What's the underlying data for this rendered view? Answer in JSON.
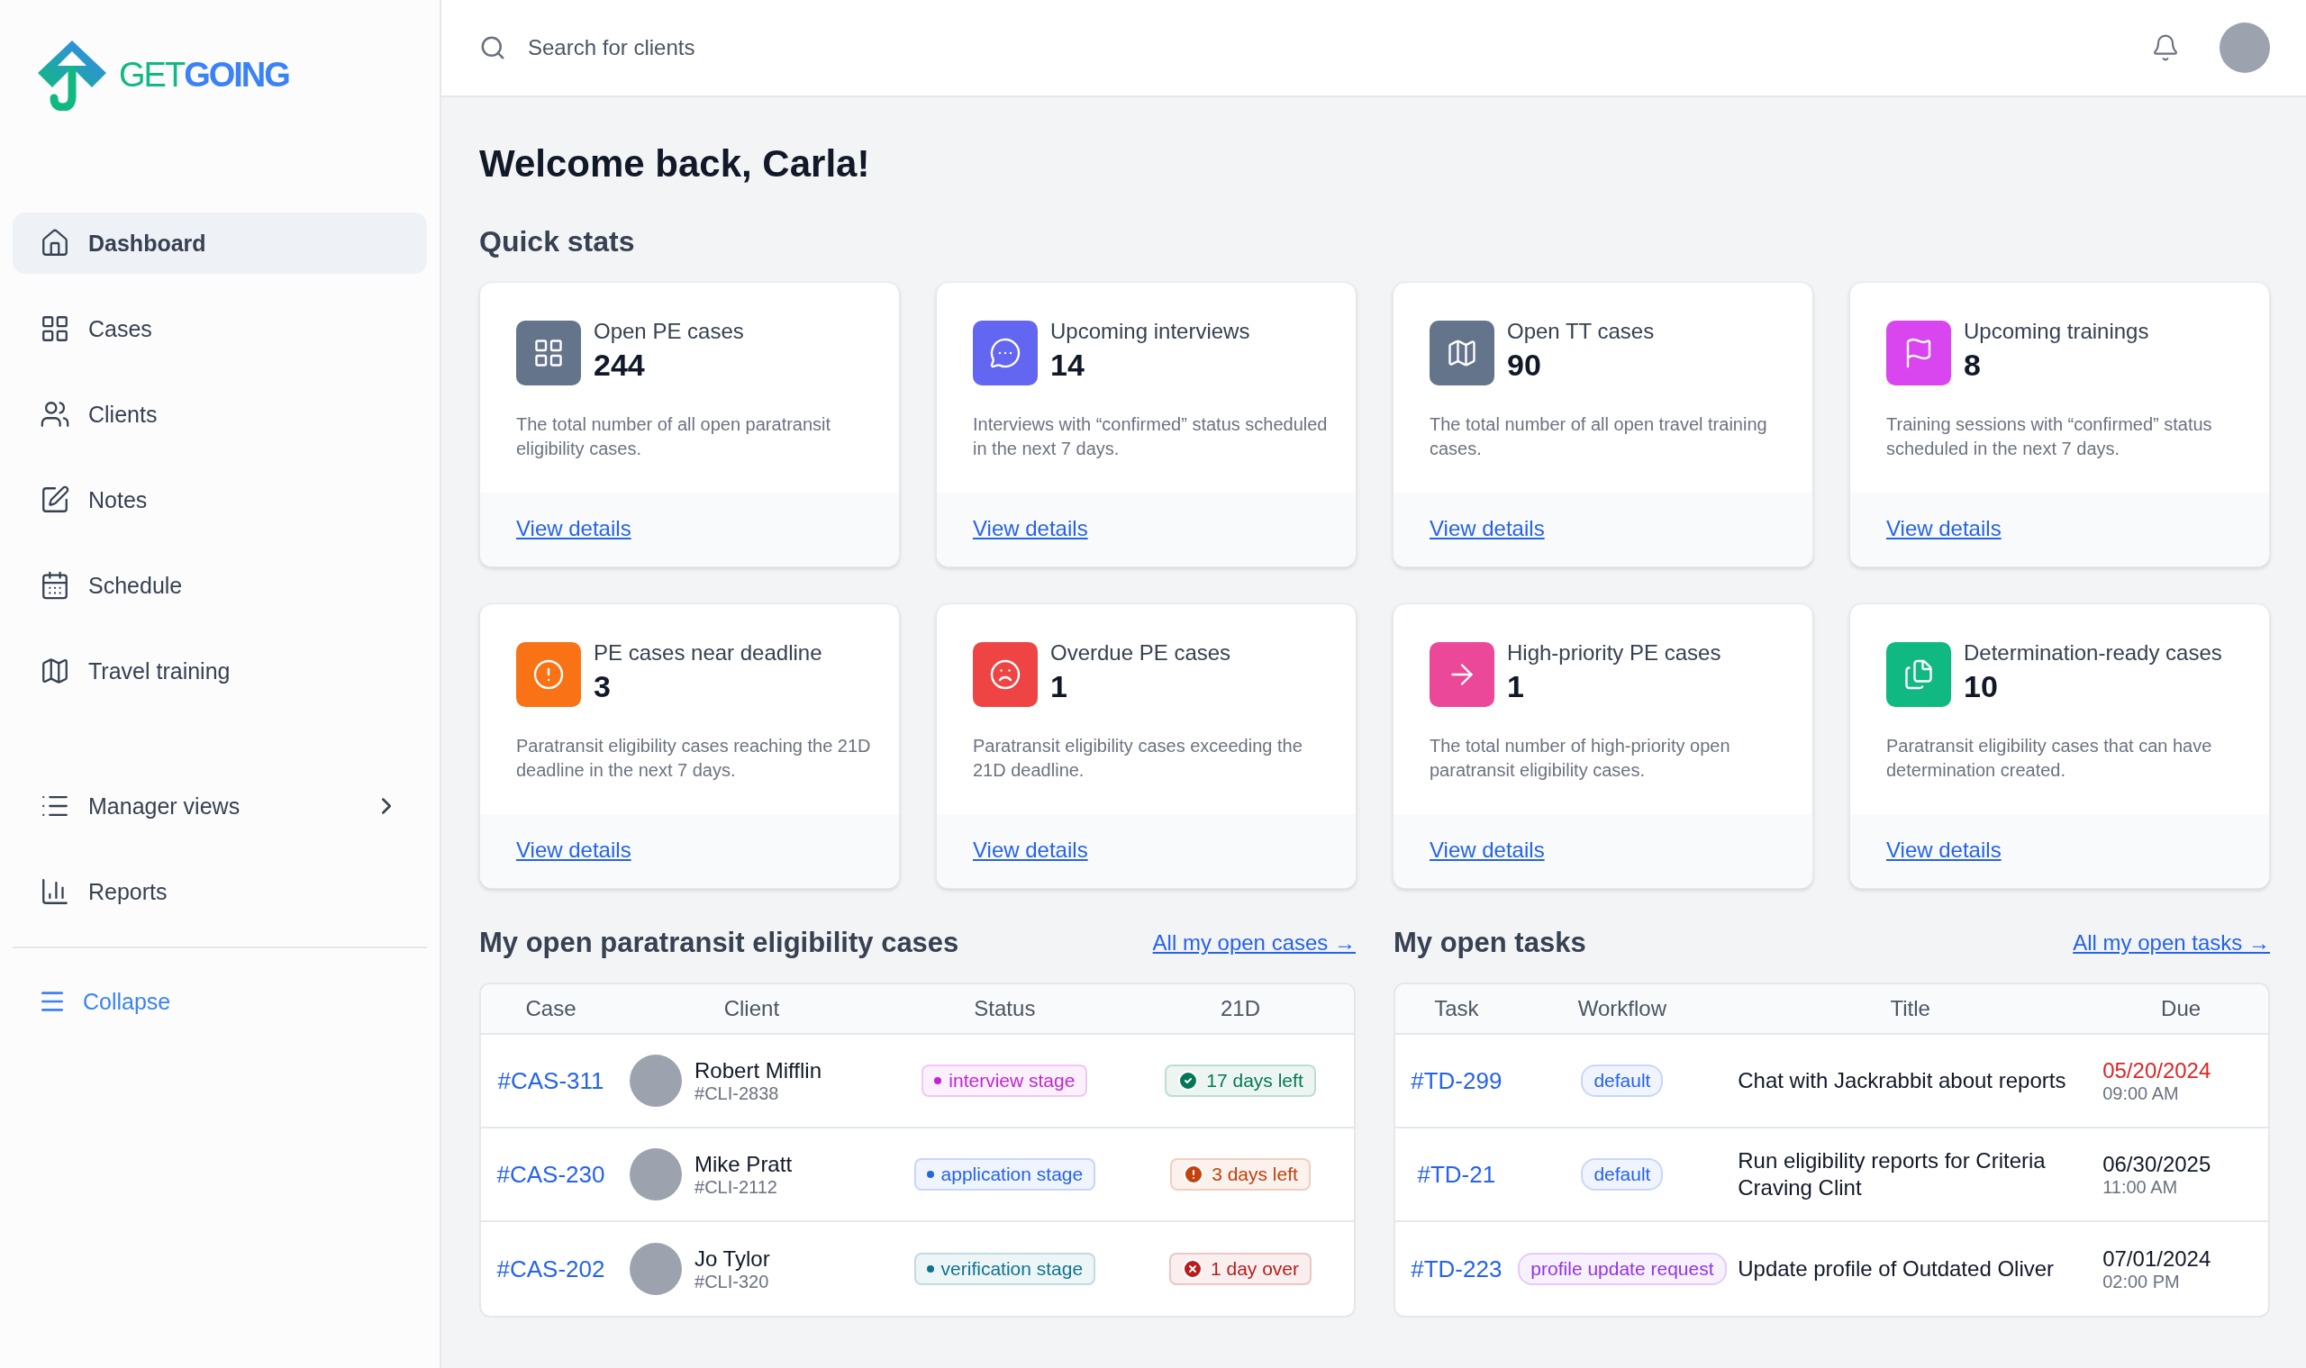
{
  "sidebar": {
    "logo": {
      "part_1": "GET",
      "part_2": "GOING"
    },
    "items": [
      {
        "label": "Dashboard",
        "selected": true,
        "kind": "link"
      },
      {
        "label": "Cases",
        "selected": false,
        "kind": "link"
      },
      {
        "label": "Clients",
        "selected": false,
        "kind": "link"
      },
      {
        "label": "Notes",
        "selected": false,
        "kind": "link"
      },
      {
        "label": "Schedule",
        "selected": false,
        "kind": "link"
      },
      {
        "label": "Travel training",
        "selected": false,
        "kind": "link"
      },
      {
        "label": "Manager views",
        "selected": false,
        "kind": "submenu"
      },
      {
        "label": "Reports",
        "selected": false,
        "kind": "link"
      }
    ],
    "collapse": "Collapse"
  },
  "header": {
    "search": {
      "placeholder": "Search for clients"
    }
  },
  "welcome": "Welcome back, Carla!",
  "quick_stats": {
    "title": "Quick stats",
    "cards": [
      {
        "title": "Open PE cases",
        "value": "244",
        "description": "The total number of all open paratransit eligibility cases.",
        "link": "View details",
        "color": "#64748b"
      },
      {
        "title": "Upcoming interviews",
        "value": "14",
        "description": "Interviews with “confirmed” status scheduled in the next 7 days.",
        "link": "View details",
        "color": "#6366f1"
      },
      {
        "title": "Open TT cases",
        "value": "90",
        "description": "The total number of all open travel training cases.",
        "link": "View details",
        "color": "#64748b"
      },
      {
        "title": "Upcoming trainings",
        "value": "8",
        "description": "Training sessions with “confirmed” status scheduled in the next 7 days.",
        "link": "View details",
        "color": "#d946ef"
      },
      {
        "title": "PE cases near deadline",
        "value": "3",
        "description": "Paratransit eligibility cases reaching the 21D deadline in the next 7 days.",
        "link": "View details",
        "color": "#f97316"
      },
      {
        "title": "Overdue PE cases",
        "value": "1",
        "description": "Paratransit eligibility cases exceeding the 21D deadline.",
        "link": "View details",
        "color": "#ef4444"
      },
      {
        "title": "High-priority PE cases",
        "value": "1",
        "description": "The total number of high-priority open paratransit eligibility cases.",
        "link": "View details",
        "color": "#ec4899"
      },
      {
        "title": "Determination-ready cases",
        "value": "10",
        "description": "Paratransit eligibility cases that can have determination created.",
        "link": "View details",
        "color": "#10b981"
      }
    ]
  },
  "cases_table": {
    "title": "My open paratransit eligibility cases",
    "link": "All my open cases →",
    "columns": [
      "Case",
      "Client",
      "Status",
      "21D"
    ],
    "rows": [
      {
        "case": "#CAS-311",
        "client_name": "Robert Mifflin",
        "client_id": "#CLI-2838",
        "status": "interview stage",
        "color": "#c026d3",
        "deadline": "17 days left",
        "kind": "ok"
      },
      {
        "case": "#CAS-230",
        "client_name": "Mike Pratt",
        "client_id": "#CLI-2112",
        "status": "application stage",
        "color": "#2563eb",
        "deadline": "3 days left",
        "kind": "warn"
      },
      {
        "case": "#CAS-202",
        "client_name": "Jo Tylor",
        "client_id": "#CLI-320",
        "status": "verification stage",
        "color": "#0e7490",
        "deadline": "1 day over",
        "kind": "over"
      }
    ]
  },
  "tasks_table": {
    "title": "My open tasks",
    "link": "All my open tasks →",
    "columns": [
      "Task",
      "Workflow",
      "Title",
      "Due"
    ],
    "rows": [
      {
        "task": "#TD-299",
        "workflow": "default",
        "color": "#2563eb",
        "title": "Chat with Jackrabbit about reports",
        "due_date": "05/20/2024",
        "due_time": "09:00 AM",
        "overdue": true
      },
      {
        "task": "#TD-21",
        "workflow": "default",
        "color": "#2563eb",
        "title": "Run eligibility reports for Criteria Craving Clint",
        "due_date": "06/30/2025",
        "due_time": "11:00 AM",
        "overdue": false
      },
      {
        "task": "#TD-223",
        "workflow": "profile update request",
        "color": "#9333ea",
        "title": "Update profile of Outdated Oliver",
        "due_date": "07/01/2024",
        "due_time": "02:00 PM",
        "overdue": false
      }
    ]
  }
}
